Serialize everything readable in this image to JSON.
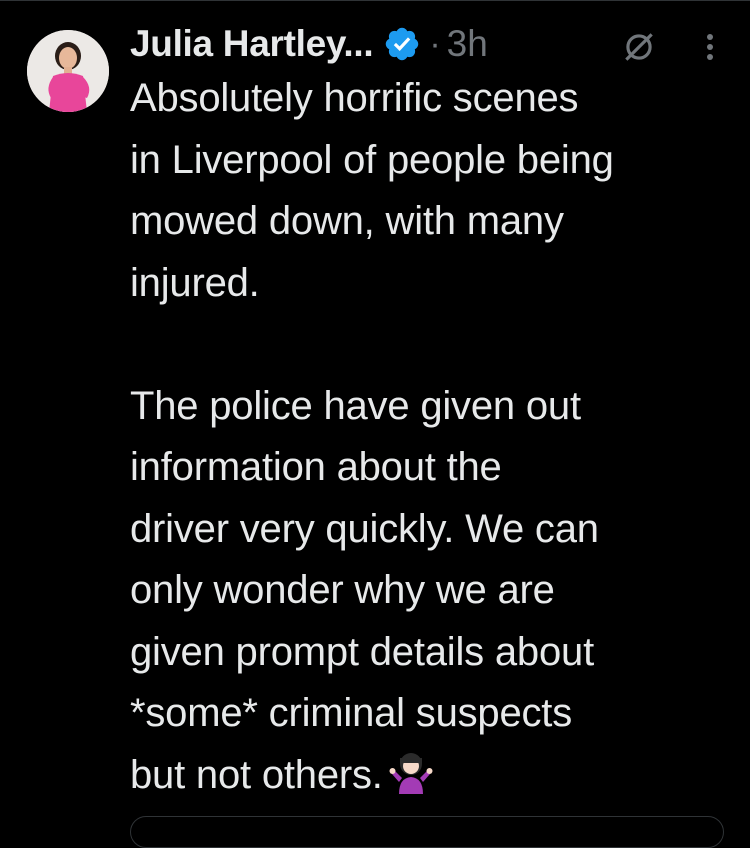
{
  "tweet": {
    "author_name": "Julia Hartley...",
    "verified": true,
    "separator": "·",
    "timestamp": "3h",
    "paragraphs": [
      "Absolutely horrific scenes\nin Liverpool of people being\nmowed down, with many\ninjured.",
      "The police have given out\ninformation about the\ndriver very quickly. We can\nonly wonder why we are\ngiven prompt details about\n*some* criminal suspects\nbut not others."
    ]
  },
  "icons": {
    "verified": "verified-badge-icon",
    "grok": "grok-icon",
    "more": "more-options-icon",
    "emoji": "person-shrugging-emoji"
  },
  "colors": {
    "background": "#000000",
    "text_primary": "#e7e9ea",
    "text_secondary": "#71767b",
    "verified_blue": "#1d9bf0",
    "divider": "#2f3336"
  }
}
